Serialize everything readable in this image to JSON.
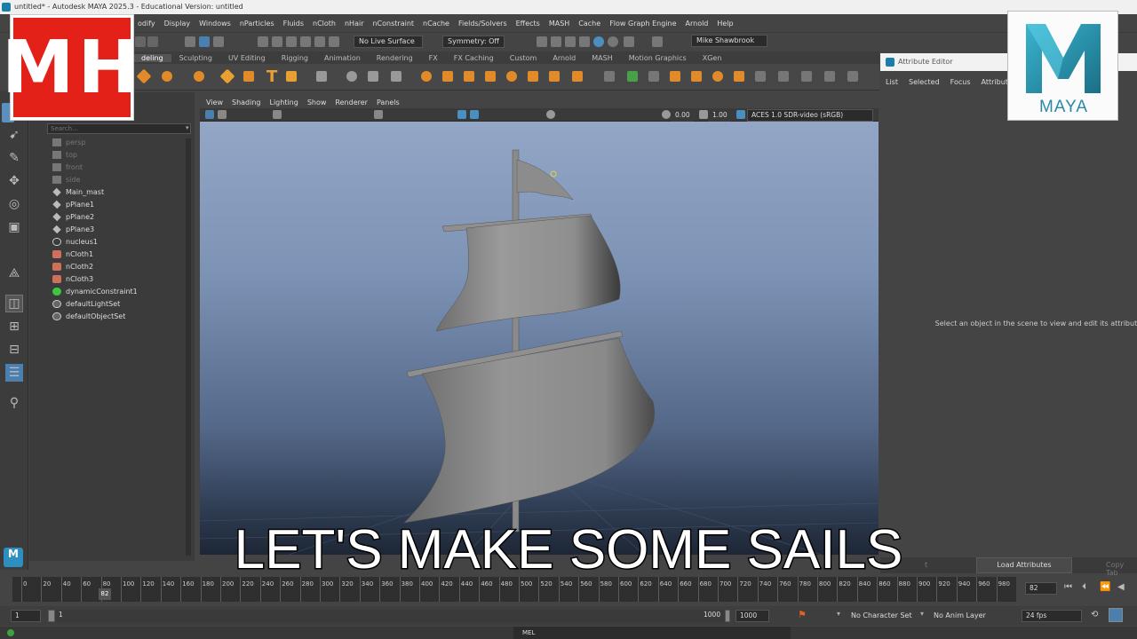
{
  "window": {
    "title": "untitled* - Autodesk MAYA 2025.3 - Educational Version: untitled"
  },
  "menubar": [
    "odify",
    "Display",
    "Windows",
    "nParticles",
    "Fluids",
    "nCloth",
    "nHair",
    "nConstraint",
    "nCache",
    "Fields/Solvers",
    "Effects",
    "MASH",
    "Cache",
    "Flow Graph Engine",
    "Arnold",
    "Help"
  ],
  "statusline": {
    "live_surface": "No Live Surface",
    "symmetry": "Symmetry: Off",
    "user": "Mike Shawbrook"
  },
  "shelf_tabs": [
    {
      "label": "deling",
      "active": true
    },
    {
      "label": "Sculpting",
      "active": false
    },
    {
      "label": "UV Editing",
      "active": false
    },
    {
      "label": "Rigging",
      "active": false
    },
    {
      "label": "Animation",
      "active": false
    },
    {
      "label": "Rendering",
      "active": false
    },
    {
      "label": "FX",
      "active": false
    },
    {
      "label": "FX Caching",
      "active": false
    },
    {
      "label": "Custom",
      "active": false
    },
    {
      "label": "Arnold",
      "active": false
    },
    {
      "label": "MASH",
      "active": false
    },
    {
      "label": "Motion Graphics",
      "active": false
    },
    {
      "label": "XGen",
      "active": false
    }
  ],
  "outliner": {
    "search_placeholder": "Search...",
    "items": [
      {
        "label": "persp",
        "icon": "camera-icon",
        "dim": true
      },
      {
        "label": "top",
        "icon": "camera-icon",
        "dim": true
      },
      {
        "label": "front",
        "icon": "camera-icon",
        "dim": true
      },
      {
        "label": "side",
        "icon": "camera-icon",
        "dim": true
      },
      {
        "label": "Main_mast",
        "icon": "group-icon",
        "dim": false
      },
      {
        "label": "pPlane1",
        "icon": "group-icon",
        "dim": false
      },
      {
        "label": "pPlane2",
        "icon": "group-icon",
        "dim": false
      },
      {
        "label": "pPlane3",
        "icon": "group-icon",
        "dim": false
      },
      {
        "label": "nucleus1",
        "icon": "nucleus-icon",
        "dim": false
      },
      {
        "label": "nCloth1",
        "icon": "ncloth-icon",
        "dim": false
      },
      {
        "label": "nCloth2",
        "icon": "ncloth-icon",
        "dim": false
      },
      {
        "label": "nCloth3",
        "icon": "ncloth-icon",
        "dim": false
      },
      {
        "label": "dynamicConstraint1",
        "icon": "constraint-icon",
        "dim": false
      },
      {
        "label": "defaultLightSet",
        "icon": "set-icon",
        "dim": false
      },
      {
        "label": "defaultObjectSet",
        "icon": "set-icon",
        "dim": false
      }
    ]
  },
  "panel": {
    "menus": [
      "View",
      "Shading",
      "Lighting",
      "Show",
      "Renderer",
      "Panels"
    ],
    "exposure": "0.00",
    "gamma": "1.00",
    "colorspace": "ACES 1.0 SDR-video (sRGB)"
  },
  "attribute_editor": {
    "title": "Attribute Editor",
    "menus": [
      "List",
      "Selected",
      "Focus",
      "Attributes"
    ],
    "message": "Select an object in the scene to view and edit its attributes",
    "load_button": "Load Attributes",
    "left_tab": "t",
    "right_tab": "Copy Tab"
  },
  "timeline": {
    "ticks": [
      "0",
      "20",
      "40",
      "60",
      "80",
      "100",
      "120",
      "140",
      "160",
      "180",
      "200",
      "220",
      "240",
      "260",
      "280",
      "300",
      "320",
      "340",
      "360",
      "380",
      "400",
      "420",
      "440",
      "460",
      "480",
      "500",
      "520",
      "540",
      "560",
      "580",
      "600",
      "620",
      "640",
      "660",
      "680",
      "700",
      "720",
      "740",
      "760",
      "780",
      "800",
      "820",
      "840",
      "860",
      "880",
      "900",
      "920",
      "940",
      "960",
      "980"
    ],
    "current_frame_marker": "82",
    "current_frame": "82"
  },
  "range": {
    "start": "1",
    "inner_start": "1",
    "inner_end": "1000",
    "end": "1000",
    "character_set": "No Character Set",
    "anim_layer": "No Anim Layer",
    "fps": "24 fps"
  },
  "cmdline": {
    "label": "MEL"
  },
  "overlay": {
    "channel_logo": "MH",
    "maya_logo": "MAYA",
    "caption": "LET'S MAKE SOME SAILS",
    "maya_icon": "M"
  },
  "colors": {
    "brand_red": "#e32118",
    "maya_teal": "#2a8aa6",
    "viewport_top": "#93a6c6",
    "viewport_bottom": "#232d3e"
  }
}
